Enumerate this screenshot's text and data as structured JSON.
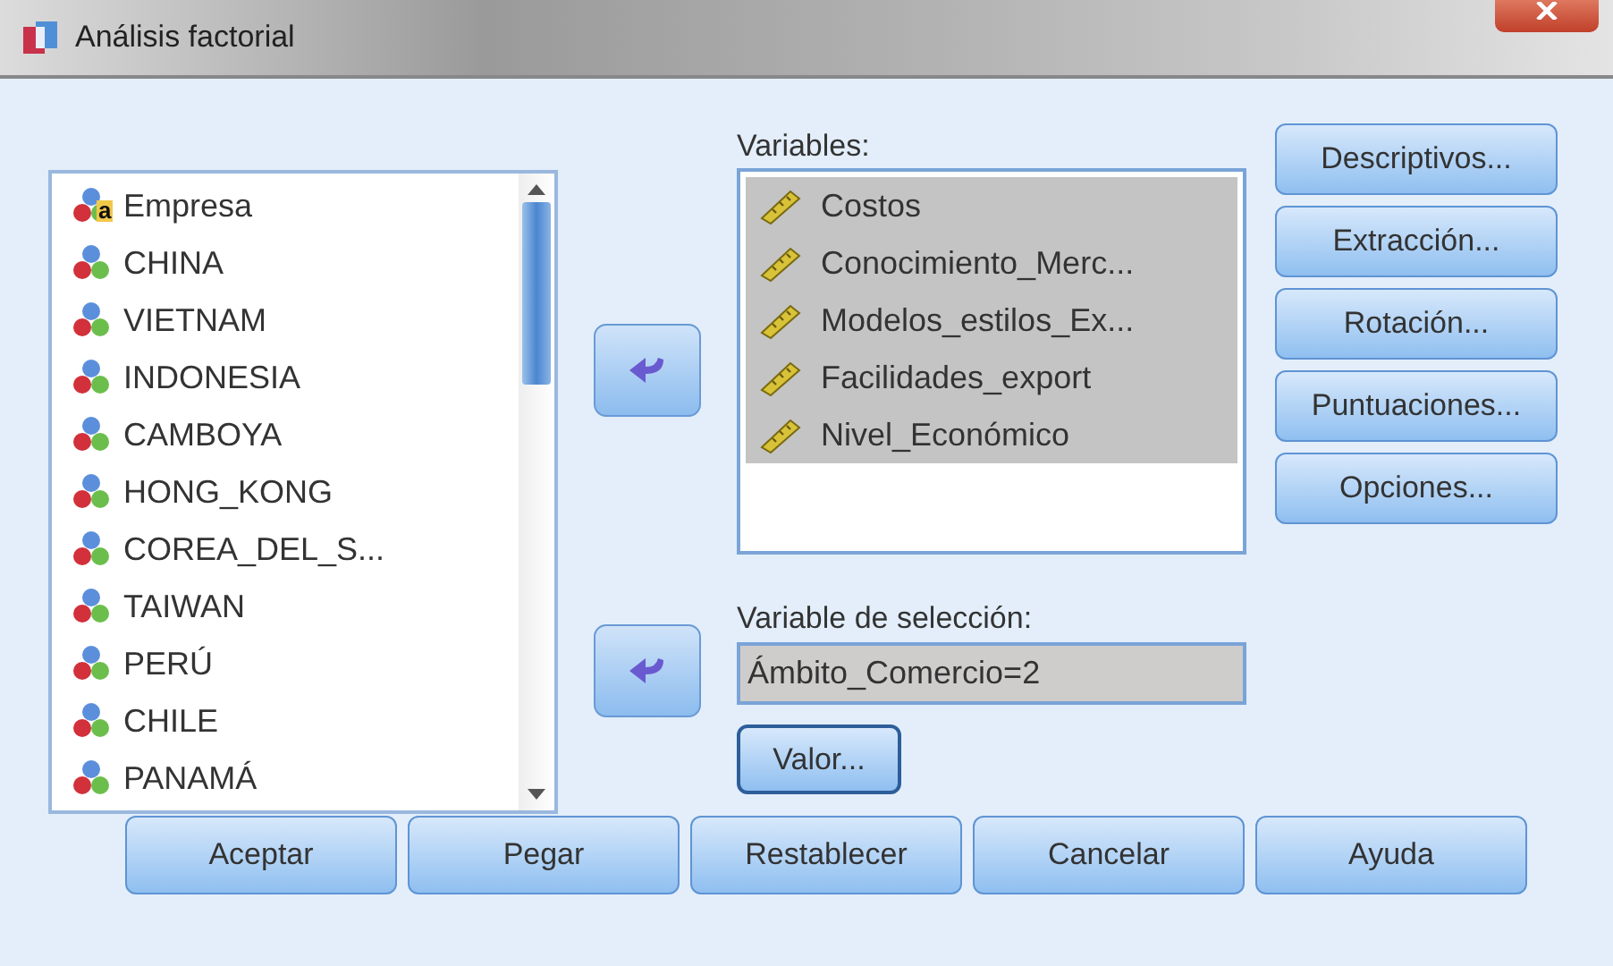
{
  "window": {
    "title": "Análisis factorial"
  },
  "source_list": {
    "items": [
      {
        "label": "Empresa",
        "kind": "string",
        "type_badge": "a"
      },
      {
        "label": "CHINA",
        "kind": "nominal"
      },
      {
        "label": "VIETNAM",
        "kind": "nominal"
      },
      {
        "label": "INDONESIA",
        "kind": "nominal"
      },
      {
        "label": "CAMBOYA",
        "kind": "nominal"
      },
      {
        "label": "HONG_KONG",
        "kind": "nominal"
      },
      {
        "label": "COREA_DEL_S...",
        "kind": "nominal"
      },
      {
        "label": "TAIWAN",
        "kind": "nominal"
      },
      {
        "label": "PERÚ",
        "kind": "nominal"
      },
      {
        "label": "CHILE",
        "kind": "nominal"
      },
      {
        "label": "PANAMÁ",
        "kind": "nominal"
      }
    ]
  },
  "variables": {
    "label": "Variables:",
    "items": [
      {
        "label": "Costos",
        "kind": "scale",
        "selected": true
      },
      {
        "label": "Conocimiento_Merc...",
        "kind": "scale",
        "selected": true
      },
      {
        "label": "Modelos_estilos_Ex...",
        "kind": "scale",
        "selected": true
      },
      {
        "label": "Facilidades_export",
        "kind": "scale",
        "selected": true
      },
      {
        "label": "Nivel_Económico",
        "kind": "scale",
        "selected": true
      }
    ]
  },
  "selection_variable": {
    "label": "Variable de selección:",
    "value": "Ámbito_Comercio=2",
    "button": "Valor..."
  },
  "side_buttons": [
    "Descriptivos...",
    "Extracción...",
    "Rotación...",
    "Puntuaciones...",
    "Opciones..."
  ],
  "bottom_buttons": [
    "Aceptar",
    "Pegar",
    "Restablecer",
    "Cancelar",
    "Ayuda"
  ]
}
